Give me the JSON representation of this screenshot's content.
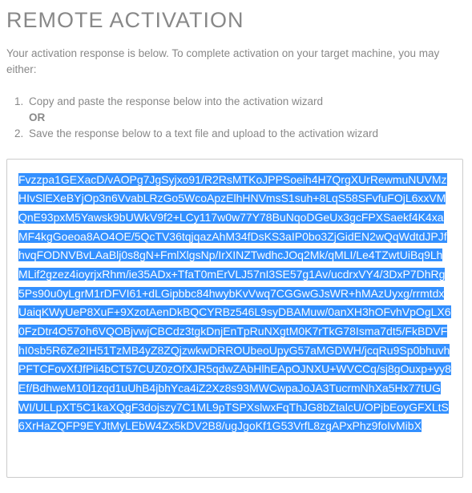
{
  "page": {
    "title": "REMOTE ACTIVATION",
    "intro": "Your activation response is below. To complete activation on your target machine, you may either:",
    "instructions": {
      "step1": "Copy and paste the response below into the activation wizard",
      "or": "OR",
      "step2": "Save the response below to a text file and upload to the activation wizard"
    },
    "response_text": "Fvzzpa1GEXacD/vAOPg7JgSyjxo91/R2RsMTKoJPPSoeih4H7QrgXUrRewmuNUVMzHIvSlEXeBYjOp3n6VvabLRzGo5WcoApzElhHNVmsS1suh+8LqS58SFvfuFOjL6xxVMQnE93pxM5Yawsk9bUWkV9f2+LCy117w0w77Y78BuNqoDGeUx3gcFPXSaekf4K4xaMF4kgGoeoa8AO4OE/5QcTV36tqjqazAhM34fDsKS3aIP0bo3ZjGidEN2wQqWdtdJPJfhvqFODNVBvLAaBlj0s8gN+FmlXlgsNp/IrXINZTwdhcJOq2Mk/qMLI/Le4TZwtUiBq9LhMLif2gzez4ioyrjxRhm/ie35ADx+TfaT0mErVLJ57nI3SE57g1Av/ucdrxVY4/3DxP7DhRg5Ps90u0yLgrM1rDFVI61+dLGipbbc84hwybKvVwq7CGGwGJsWR+hMAzUyxg/rrmtdxUaiqKWyUeP8XuF+9XzotAenDkBQCYRBz546L9syDBAMuw/0anXH3hOFvhVpOgLX60FzDtr4O57oh6VQOBjvwjCBCdz3tgkDnjEnTpRuNXgtM0K7rTkG78Isma7dt5/FkBDVFhI0sb5R6Ze2IH51TzMB4yZ8ZQjzwkwDRROUbeoUpyG57aMGDWH/jcqRu9Sp0bhuvhPFTCFovXfJfPii4bCT57CUZ0zOfXJR5qdwZAbHlhEApOJNXU+WVCCq/sj8gOuxp+yy8Ef/BdhweM10l1zqd1uUhB4jbhYca4iZ2Xz8s93MWCwpaJoJA3TucrmNhXa5Hx77tUGWI/ULLpXT5C1kaXQgF3dojszy7C1ML9pTSPXslwxFqThJG8bZtalcU/OPjbEoyGFXLtS6XrHaZQFP9EYJtMyLEbW4Zx5kDV2B8/ugJgoKf1G53VrfL8zgAPxPhz9foIvMibX"
  }
}
